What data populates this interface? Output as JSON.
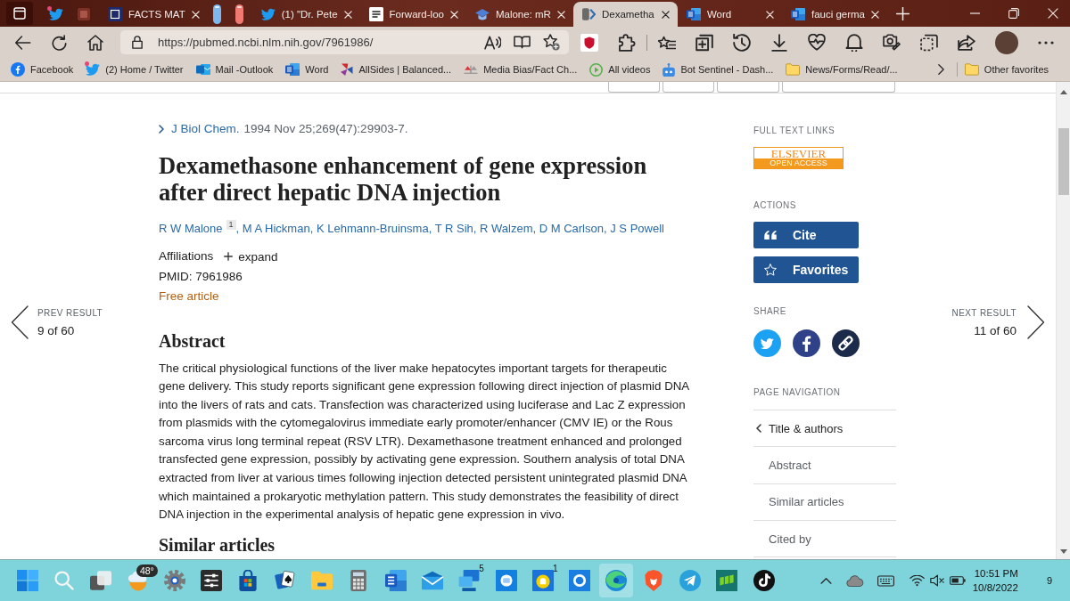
{
  "browser": {
    "tabs": [
      {
        "selected": false
      },
      {
        "selected": false
      },
      {
        "title": "FACTS MAT",
        "selected": false
      },
      {
        "selected": false
      },
      {
        "selected": false
      },
      {
        "title": "(1) \"Dr. Pete",
        "selected": false
      },
      {
        "title": "Forward-loo",
        "selected": false
      },
      {
        "title": "Malone: mR",
        "selected": false
      },
      {
        "title": "Dexametha",
        "selected": true
      },
      {
        "title": "Word",
        "selected": false
      },
      {
        "title": "fauci germa",
        "selected": false
      }
    ],
    "address_bar": {
      "url": "https://pubmed.ncbi.nlm.nih.gov/7961986/"
    },
    "favorites_bar": {
      "items": [
        {
          "label": "Facebook"
        },
        {
          "label": "(2) Home / Twitter"
        },
        {
          "label": "Mail -Outlook"
        },
        {
          "label": "Word"
        },
        {
          "label": "AllSides | Balanced..."
        },
        {
          "label": "Media Bias/Fact Ch..."
        },
        {
          "label": "All videos"
        },
        {
          "label": "Bot Sentinel - Dash..."
        },
        {
          "label": "News/Forms/Read/..."
        }
      ],
      "other_favorites": "Other favorites"
    }
  },
  "page": {
    "navigation": {
      "previous": {
        "label": "PREV RESULT",
        "position": "9 of 60"
      },
      "next": {
        "label": "NEXT RESULT",
        "position": "11 of 60"
      }
    },
    "article": {
      "journal": "J Biol Chem.",
      "citation": "1994 Nov 25;269(47):29903-7.",
      "title": "Dexamethasone enhancement of gene expression after direct hepatic DNA injection",
      "authors": [
        {
          "name": "R W Malone",
          "affiliation": "1",
          "separator": ","
        },
        {
          "name": "M A Hickman",
          "separator": ","
        },
        {
          "name": "K Lehmann-Bruinsma",
          "separator": ","
        },
        {
          "name": "T R Sih",
          "separator": ","
        },
        {
          "name": "R Walzem",
          "separator": ","
        },
        {
          "name": "D M Carlson",
          "separator": ","
        },
        {
          "name": "J S Powell"
        }
      ],
      "affiliations": "Affiliations",
      "expand": "expand",
      "pmid": "PMID: 7961986",
      "free_article": "Free article",
      "abstract_heading": "Abstract",
      "abstract": "The critical physiological functions of the liver make hepatocytes important targets for therapeutic gene delivery. This study reports significant gene expression following direct injection of plasmid DNA into the livers of rats and cats. Transfection was characterized using luciferase and Lac Z expression from plasmids with the cytomegalovirus immediate early promoter/enhancer (CMV IE) or the Rous sarcoma virus long terminal repeat (RSV LTR). Dexamethasone treatment enhanced and prolonged transfected gene expression, possibly by activating gene expression. Southern analysis of total DNA extracted from liver at various times following injection detected persistent unintegrated plasmid DNA which maintained a prokaryotic methylation pattern. This study demonstrates the feasibility of direct DNA injection in the experimental analysis of hepatic gene expression in vivo.",
      "similar_heading": "Similar articles"
    },
    "sidebar": {
      "full_text_links": {
        "heading": "FULL TEXT LINKS",
        "publisher": "ELSEVIER",
        "access": "OPEN ACCESS"
      },
      "actions": {
        "heading": "ACTIONS",
        "buttons": [
          {
            "label": "Cite"
          },
          {
            "label": "Favorites"
          }
        ]
      },
      "share": {
        "heading": "SHARE"
      },
      "page_navigation": {
        "heading": "PAGE NAVIGATION",
        "items": [
          {
            "label": "Title & authors",
            "selected": true
          },
          {
            "label": "Abstract",
            "selected": false
          },
          {
            "label": "Similar articles",
            "selected": false
          },
          {
            "label": "Cited by",
            "selected": false
          }
        ]
      }
    }
  },
  "taskbar": {
    "apps": [
      {
        "badge": "48°",
        "selected": false
      },
      {
        "selected": false
      },
      {
        "selected": false
      },
      {
        "selected": false
      },
      {
        "selected": false
      },
      {
        "selected": false
      },
      {
        "selected": false
      },
      {
        "selected": false
      },
      {
        "selected": false
      },
      {
        "badge": "5",
        "selected": false
      },
      {
        "selected": false
      },
      {
        "badge": "1",
        "selected": false
      },
      {
        "selected": false
      },
      {
        "selected": true
      },
      {
        "selected": false
      },
      {
        "selected": false
      },
      {
        "selected": false
      },
      {
        "selected": false
      }
    ],
    "clock": {
      "time": "10:51 PM",
      "date": "10/8/2022"
    },
    "notification_count": "9"
  }
}
